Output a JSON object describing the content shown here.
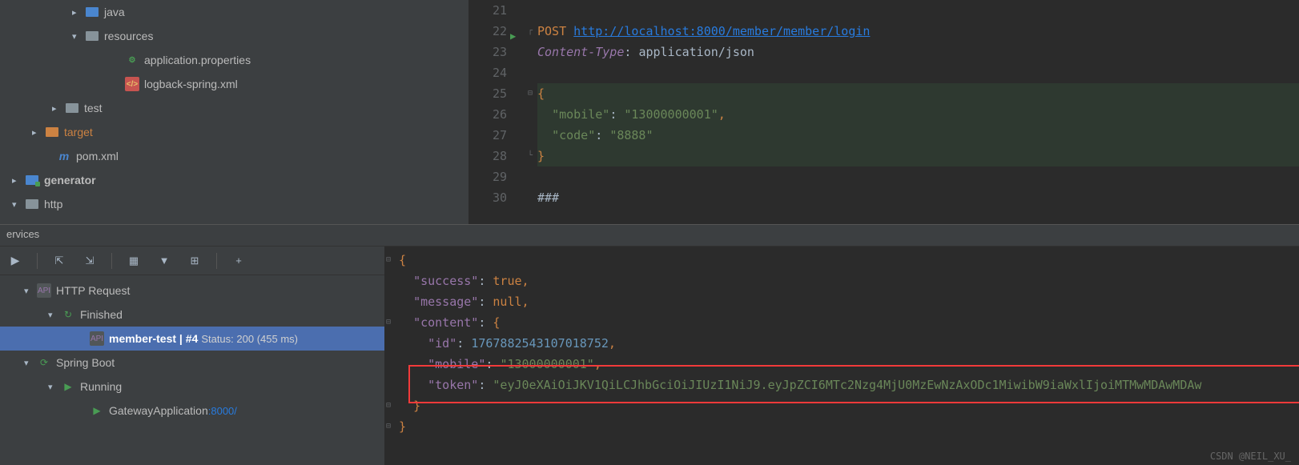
{
  "tree": {
    "java": "java",
    "resources": "resources",
    "app_props": "application.properties",
    "logback": "logback-spring.xml",
    "test": "test",
    "target": "target",
    "pom": "pom.xml",
    "generator": "generator",
    "http": "http"
  },
  "editor": {
    "lines": {
      "21": "21",
      "22": "22",
      "23": "23",
      "24": "24",
      "25": "25",
      "26": "26",
      "27": "27",
      "28": "28",
      "29": "29",
      "30": "30"
    },
    "method": "POST",
    "url": "http://localhost:8000/member/member/login",
    "header_key": "Content-Type",
    "header_val": "application/json",
    "body_open": "{",
    "mobile_key": "\"mobile\"",
    "mobile_val": "\"13000000001\"",
    "code_key": "\"code\"",
    "code_val": "\"8888\"",
    "body_close": "}",
    "end": "###"
  },
  "services_title": "ervices",
  "services": {
    "http_request": "HTTP Request",
    "finished": "Finished",
    "member_test": "member-test",
    "run_num": "#4",
    "status": "Status: 200 (455 ms)",
    "spring_boot": "Spring Boot",
    "running": "Running",
    "gateway": "GatewayApplication",
    "gateway_port": ":8000/"
  },
  "response": {
    "open": "{",
    "success_k": "\"success\"",
    "success_v": "true",
    "message_k": "\"message\"",
    "message_v": "null",
    "content_k": "\"content\"",
    "id_k": "\"id\"",
    "id_v": "1767882543107018752",
    "mobile_k": "\"mobile\"",
    "mobile_v": "\"13000000001\"",
    "token_k": "\"token\"",
    "token_v": "\"eyJ0eXAiOiJKV1QiLCJhbGciOiJIUzI1NiJ9.eyJpZCI6MTc2Nzg4MjU0MzEwNzAxODc1MiwibW9iaWxlIjoiMTMwMDAwMDAw",
    "close_inner": "}",
    "close": "}"
  },
  "watermark": "CSDN @NEIL_XU_"
}
